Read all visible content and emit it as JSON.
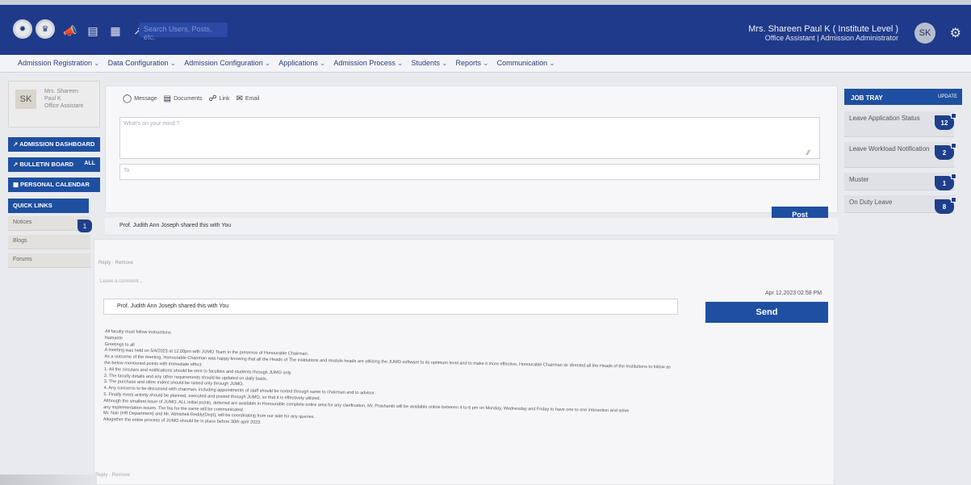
{
  "header": {
    "search_placeholder": "Search Users, Posts, etc.",
    "user_name": "Mrs. Shareen Paul K ( Institute Level )",
    "user_role": "Office Assistant | Admission Administrator",
    "avatar": "SK",
    "logos": [
      "emblem-logo",
      "institution-logo"
    ],
    "icons": [
      "megaphone-icon",
      "briefcase-icon",
      "notes-icon",
      "external-link-icon"
    ]
  },
  "menu": [
    "Admission Registration",
    "Data Configuration",
    "Admission Configuration",
    "Applications",
    "Admission Process",
    "Students",
    "Reports",
    "Communication"
  ],
  "sidebar": {
    "profile_avatar": "SK",
    "profile_lines": [
      "Mrs. Shareen",
      "Paul K",
      "Office Assistant"
    ],
    "nav": [
      {
        "label": "ADMISSION DASHBOARD",
        "badge": ""
      },
      {
        "label": "BULLETIN BOARD",
        "badge": "ALL"
      },
      {
        "label": "PERSONAL CALENDAR",
        "badge": ""
      },
      {
        "label": "QUICK LINKS",
        "badge": ""
      }
    ],
    "quick_links": [
      "Notices",
      "Blogs",
      "Forums"
    ],
    "quick_badge": "1"
  },
  "composer": {
    "types": [
      "Message",
      "Documents",
      "Link",
      "Email"
    ],
    "placeholder": "What's on your mind ?",
    "to_placeholder": "To",
    "post_label": "Post"
  },
  "feed": {
    "shared_line": "Prof. Judith Ann Joseph shared this with You",
    "reply_label": "Reply · Remove",
    "comment_label": "Leave a comment...",
    "timestamp": "Apr 12,2023 02:58 PM",
    "comment_value": "Prof. Judith Ann Joseph shared this with You",
    "send_label": "Send",
    "letter_lines": [
      "All faculty must follow instructions",
      "Namaste",
      "Greetings to all",
      "A meeting was held on 5/4/2023 at 12.00pm with JUMO Team in the presence of Honourable Chairman.",
      "As a outcome of the meeting, Honourable Chairman was happy knowing that all the Heads of The institutions and module heads are utilizing the JUMO software to its optimum level and to make it more effective, Honourable Chairman sir directed all the Heads of the Institutions to follow as",
      "the below mentioned points with immediate effect:",
      "1. All the circulars and notifications should be sent to faculties and students through JUMO only.",
      "2. The faculty details and any other requirements should be updated on daily basis.",
      "3. The purchase and other indent should be raised only through JUMO.",
      "4. Any concerns to be discussed with chairman, including appointments of staff should be sorted through same to chairman and to advisor.",
      "5. Finally every activity should be planned, executed and posted through JUMO, so that it is effectively utilized.",
      "Although the smallest issue of JUMO, ALL initial points, deferred are available in Honourable complete entire area for any clarification, Mr. Prashanth will be available online between 4 to 6 pm on Monday, Wednesday and Friday to have one to one interaction and solve",
      "any implementation issues. The fee for the same will be communicated.",
      "Mr. Nair (HR Department) and Mr. Abhishek Reddy(Dept), will be coordinating from our side for any queries.",
      "Altogether the entire process of JUMO should be in place before 30th april 2023."
    ],
    "letter_footer": "Reply · Remove"
  },
  "job_tray": {
    "title": "JOB TRAY",
    "update_label": "UPDATE",
    "items": [
      {
        "label": "Leave Application Status",
        "count": "12"
      },
      {
        "label": "Leave Workload Notification",
        "count": "2"
      },
      {
        "label": "Muster",
        "count": "1"
      },
      {
        "label": "On Duty Leave",
        "count": "8"
      }
    ]
  },
  "colors": {
    "topbar": "#1f3a8a",
    "accent": "#1e4fa0",
    "badge": "#1e3f8a"
  }
}
